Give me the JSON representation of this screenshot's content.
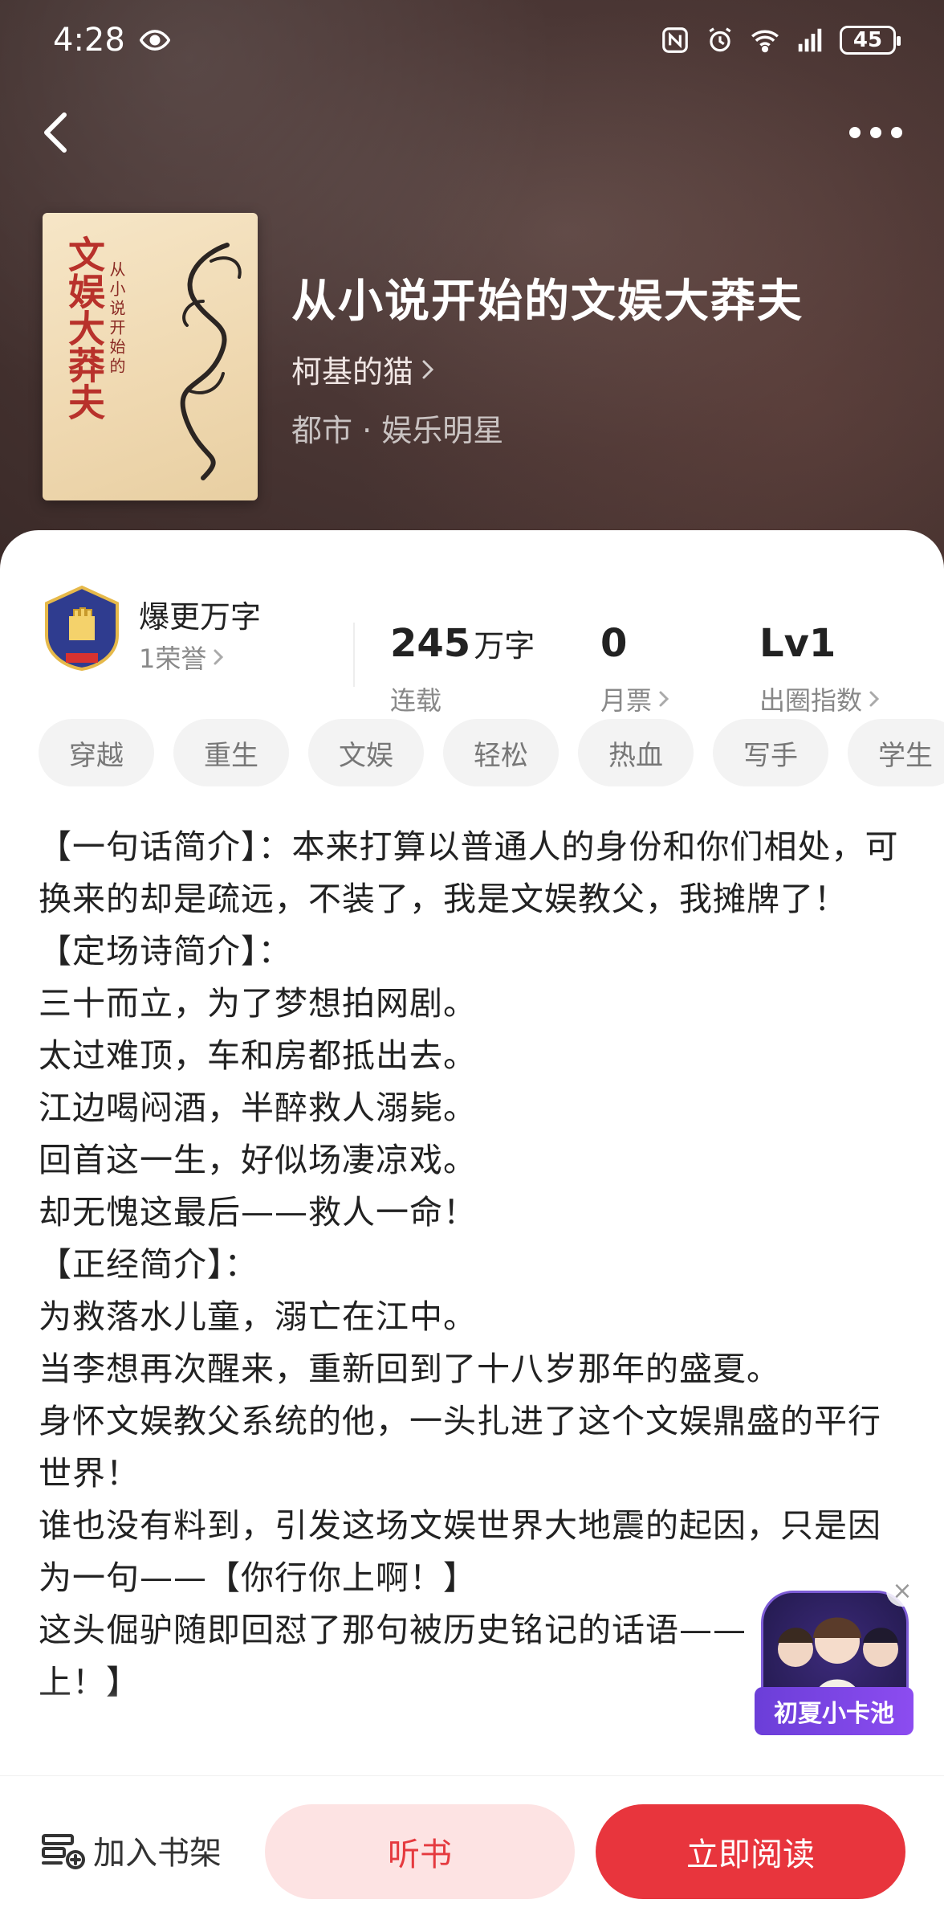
{
  "status_bar": {
    "time": "4:28",
    "battery": "45"
  },
  "book": {
    "title": "从小说开始的文娱大莽夫",
    "author": "柯基的猫",
    "category": "都市 · 娱乐明星",
    "cover_title": "文娱大莽夫",
    "cover_subtitle": "从小说开始的"
  },
  "stats": {
    "honor_title": "爆更万字",
    "honor_sub": "1荣誉",
    "words_value": "245",
    "words_unit": "万字",
    "words_label": "连载",
    "tickets_value": "0",
    "tickets_label": "月票",
    "index_value": "Lv1",
    "index_label": "出圈指数"
  },
  "tags": [
    "穿越",
    "重生",
    "文娱",
    "轻松",
    "热血",
    "写手",
    "学生"
  ],
  "description": [
    "【一句话简介】：本来打算以普通人的身份和你们相处，可换来的却是疏远，不装了，我是文娱教父，我摊牌了！",
    "【定场诗简介】：",
    "三十而立，为了梦想拍网剧。",
    "太过难顶，车和房都抵出去。",
    "江边喝闷酒，半醉救人溺毙。",
    "回首这一生，好似场凄凉戏。",
    "却无愧这最后——救人一命！",
    "【正经简介】：",
    "为救落水儿童，溺亡在江中。",
    "当李想再次醒来，重新回到了十八岁那年的盛夏。",
    "身怀文娱教父系统的他，一头扎进了这个文娱鼎盛的平行世界！",
    "谁也没有料到，引发这场文娱世界大地震的起因，只是因为一句——【你行你上啊！】",
    "这头倔驴随即回怼了那句被历史铭记的话语——【那就我上！】"
  ],
  "promo": {
    "label": "初夏小卡池"
  },
  "bottom": {
    "shelf": "加入书架",
    "listen": "听书",
    "read": "立即阅读"
  }
}
